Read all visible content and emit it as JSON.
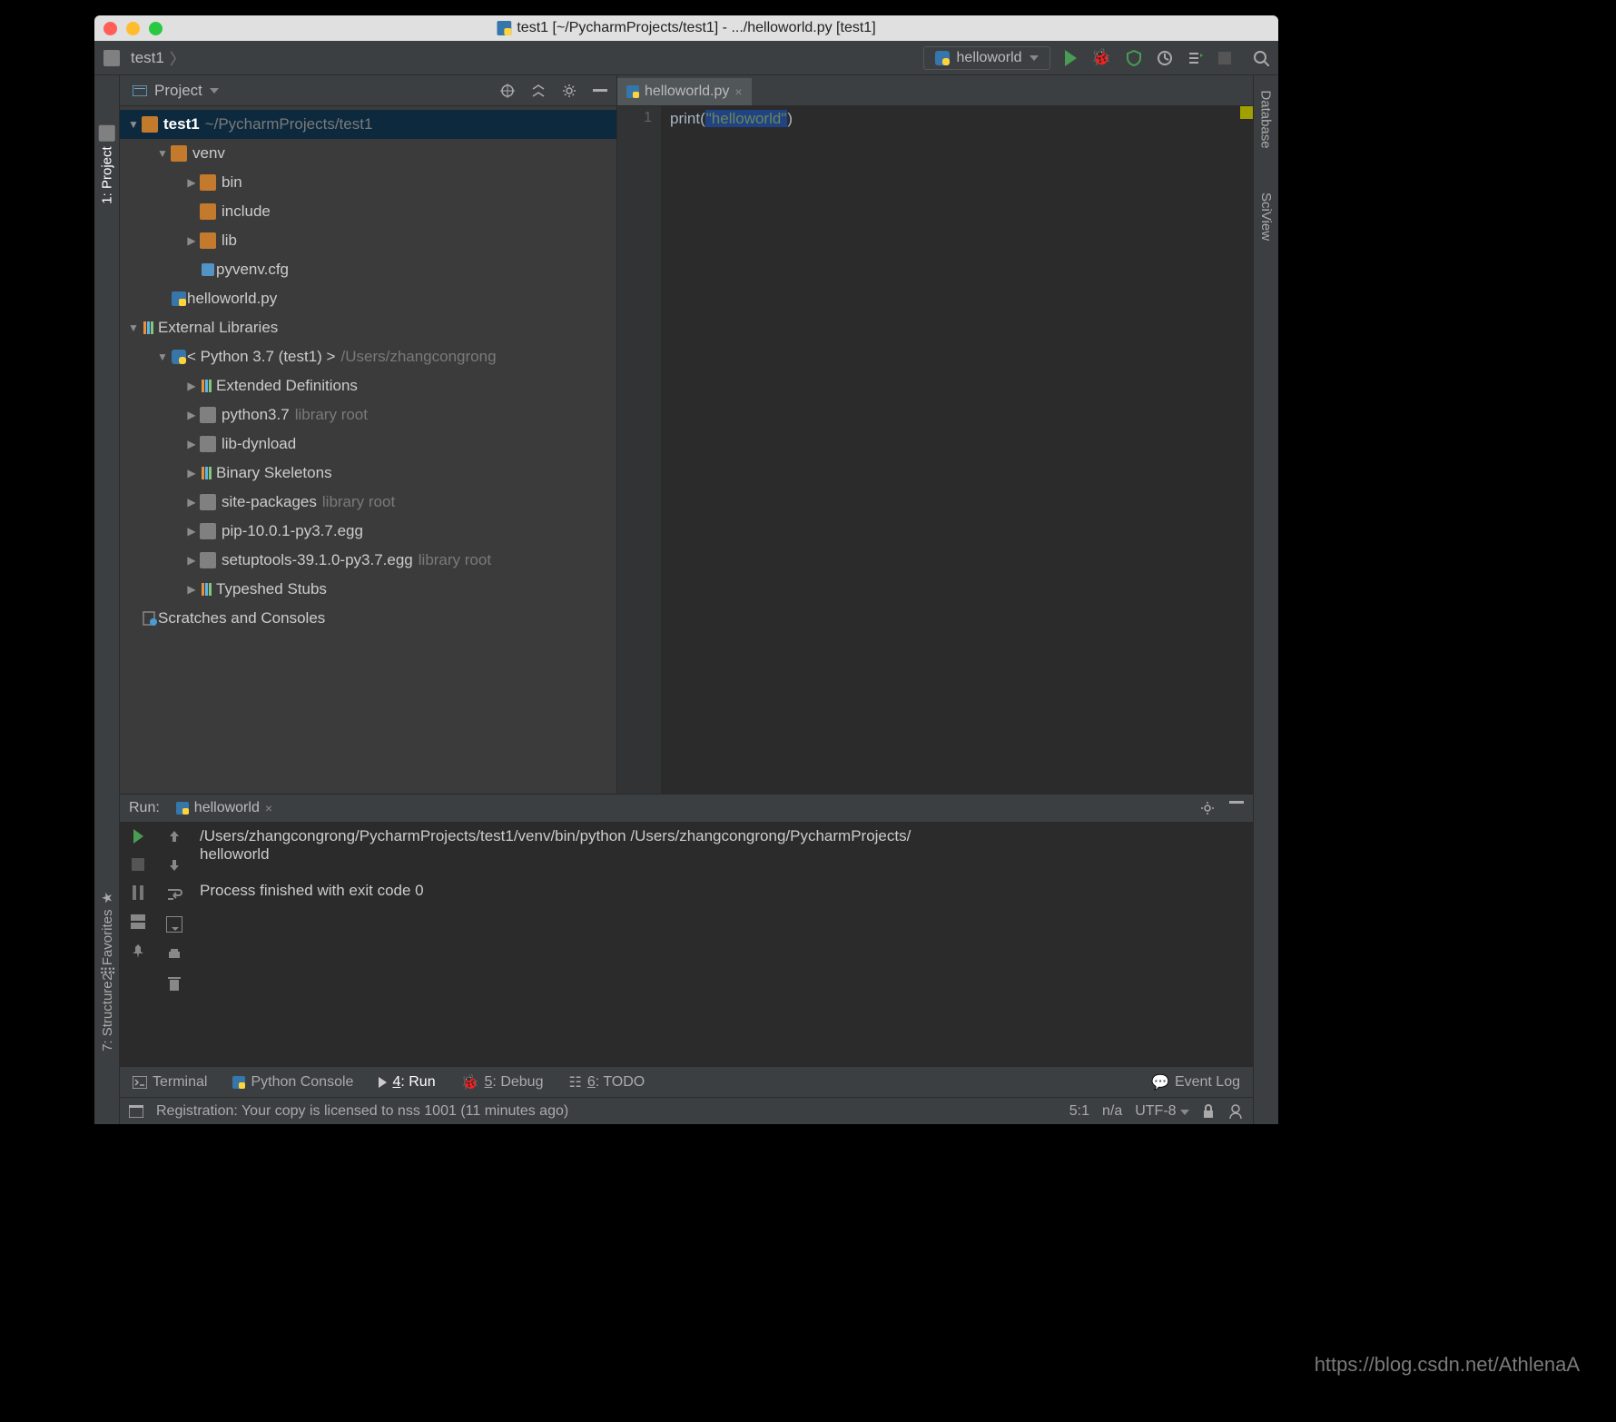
{
  "titlebar": {
    "text": "test1 [~/PycharmProjects/test1] - .../helloworld.py [test1]"
  },
  "breadcrumb": {
    "project": "test1"
  },
  "run_config": {
    "name": "helloworld"
  },
  "project_panel": {
    "title": "Project",
    "tree": {
      "root": {
        "name": "test1",
        "path": "~/PycharmProjects/test1"
      },
      "venv": {
        "name": "venv",
        "children": {
          "bin": "bin",
          "include": "include",
          "lib": "lib",
          "pyvenv": "pyvenv.cfg"
        }
      },
      "helloworld": "helloworld.py",
      "ext_lib": "External Libraries",
      "python": {
        "label": "< Python 3.7 (test1) >",
        "path": "/Users/zhangcongrong"
      },
      "ext_def": "Extended Definitions",
      "python37": {
        "name": "python3.7",
        "note": "library root"
      },
      "lib_dynload": "lib-dynload",
      "bin_skel": "Binary Skeletons",
      "site_pkg": {
        "name": "site-packages",
        "note": "library root"
      },
      "pip": "pip-10.0.1-py3.7.egg",
      "setuptools": {
        "name": "setuptools-39.1.0-py3.7.egg",
        "note": "library root"
      },
      "typeshed": "Typeshed Stubs",
      "scratches": "Scratches and Consoles"
    }
  },
  "left_tabs": {
    "project": "1: Project",
    "favorites": "2: Favorites",
    "structure": "7: Structure"
  },
  "right_tabs": {
    "database": "Database",
    "sciview": "SciView"
  },
  "editor": {
    "tab": "helloworld.py",
    "line_no": "1",
    "code_print": "print",
    "code_paren_open": "(",
    "code_str": "\"helloworld\"",
    "code_paren_close": ")"
  },
  "run_panel": {
    "title": "Run:",
    "tab": "helloworld",
    "console_line1": "/Users/zhangcongrong/PycharmProjects/test1/venv/bin/python /Users/zhangcongrong/PycharmProjects/",
    "console_line2": "helloworld",
    "console_line3": "",
    "console_line4": "Process finished with exit code 0"
  },
  "bottom_tabs": {
    "terminal": "Terminal",
    "python_console": "Python Console",
    "run": {
      "prefix": "4",
      "label": ": Run"
    },
    "debug": {
      "prefix": "5",
      "label": ": Debug"
    },
    "todo": {
      "prefix": "6",
      "label": ": TODO"
    },
    "event_log": "Event Log"
  },
  "status": {
    "registration": "Registration: Your copy is licensed to nss 1001 (11 minutes ago)",
    "cursor": "5:1",
    "na": "n/a",
    "encoding": "UTF-8"
  },
  "watermark": "https://blog.csdn.net/AthlenaA"
}
